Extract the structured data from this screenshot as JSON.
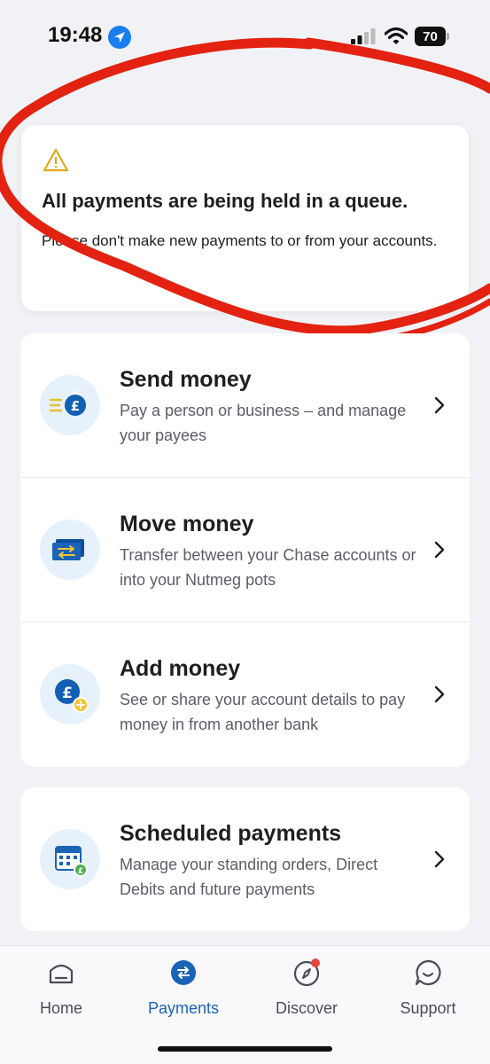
{
  "status_bar": {
    "time": "19:48",
    "battery": "70"
  },
  "alert": {
    "icon": "warning-icon",
    "title": "All payments are being held in a queue.",
    "body": "Please don't make new payments to or from your accounts."
  },
  "actions": [
    {
      "icon": "send-money-icon",
      "title": "Send money",
      "description": "Pay a person or business – and manage your payees"
    },
    {
      "icon": "move-money-icon",
      "title": "Move money",
      "description": "Transfer between your Chase accounts or into your Nutmeg pots"
    },
    {
      "icon": "add-money-icon",
      "title": "Add money",
      "description": "See or share your account details to pay money in from another bank"
    }
  ],
  "scheduled": {
    "icon": "scheduled-payments-icon",
    "title": "Scheduled payments",
    "description": "Manage your standing orders, Direct Debits and future payments"
  },
  "nav": {
    "items": [
      {
        "label": "Home",
        "icon": "home-icon"
      },
      {
        "label": "Payments",
        "icon": "payments-icon",
        "active": true
      },
      {
        "label": "Discover",
        "icon": "compass-icon",
        "badge": true
      },
      {
        "label": "Support",
        "icon": "chat-icon"
      }
    ]
  },
  "colors": {
    "accent": "#1a63b7",
    "background": "#f1f2f6",
    "warning": "#e0a91a",
    "annotation_red": "#e32211"
  }
}
